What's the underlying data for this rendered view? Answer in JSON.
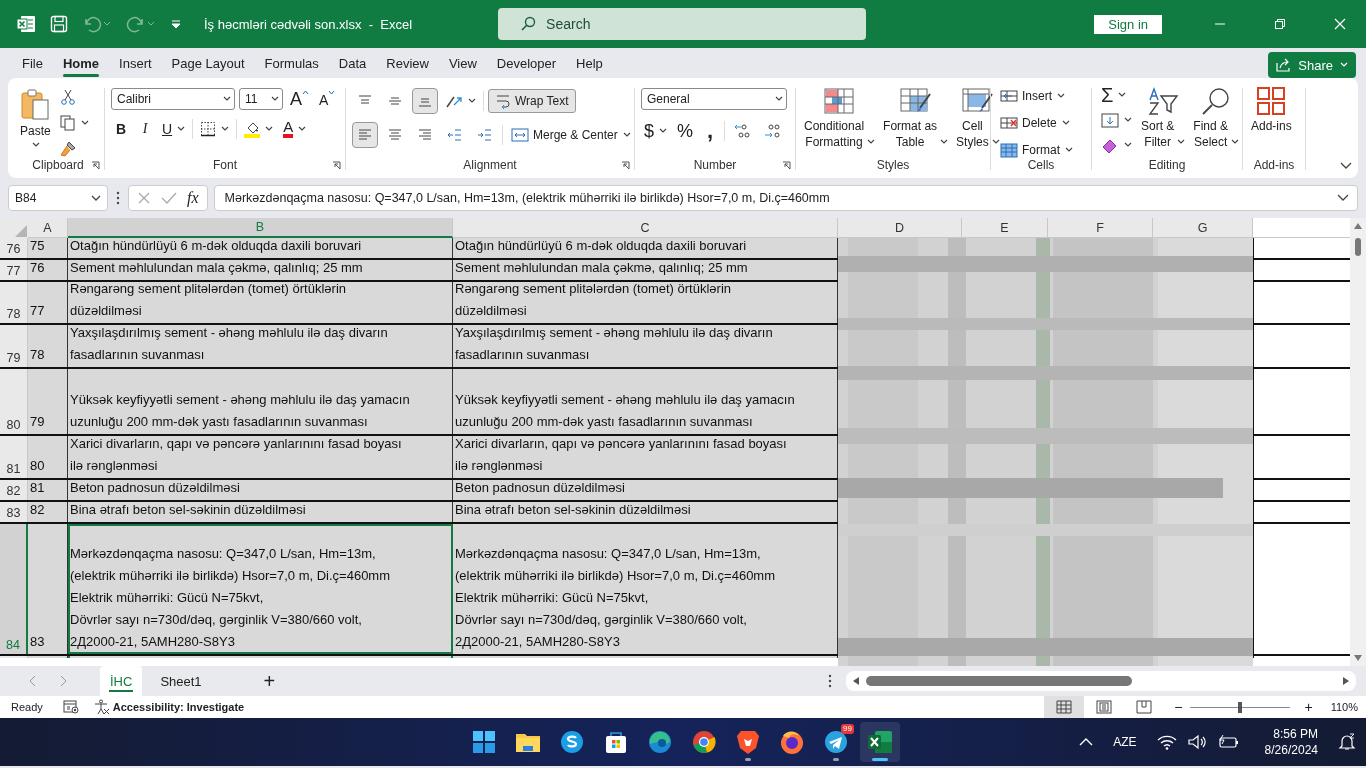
{
  "window": {
    "title": "İş həcmləri cədvəli son.xlsx  -  Excel",
    "search_placeholder": "Search",
    "sign_in": "Sign in"
  },
  "menu_tabs": [
    {
      "label": "File",
      "selected": false
    },
    {
      "label": "Home",
      "selected": true
    },
    {
      "label": "Insert",
      "selected": false
    },
    {
      "label": "Page Layout",
      "selected": false
    },
    {
      "label": "Formulas",
      "selected": false
    },
    {
      "label": "Data",
      "selected": false
    },
    {
      "label": "Review",
      "selected": false
    },
    {
      "label": "View",
      "selected": false
    },
    {
      "label": "Developer",
      "selected": false
    },
    {
      "label": "Help",
      "selected": false
    }
  ],
  "share": "Share",
  "ribbon": {
    "clipboard": {
      "paste": "Paste",
      "label": "Clipboard"
    },
    "font": {
      "name": "Calibri",
      "size": "11",
      "grow_font": "A",
      "shrink_font": "A",
      "bold": "B",
      "italic": "I",
      "underline": "U",
      "font_color": "A",
      "label": "Font"
    },
    "alignment": {
      "vertical": [
        {
          "selected": false
        },
        {
          "selected": false
        },
        {
          "selected": true
        }
      ],
      "horizontal": [
        {
          "selected": true
        },
        {
          "selected": false
        },
        {
          "selected": false
        }
      ],
      "wrap_text": {
        "label": "Wrap Text",
        "on": true
      },
      "merge": "Merge & Center",
      "label": "Alignment"
    },
    "number": {
      "format": "General",
      "currency": "$",
      "percent": "%",
      "comma": ",",
      "label": "Number"
    },
    "styles": {
      "buttons": [
        "Conditional\nFormatting",
        "Format as\nTable",
        "Cell\nStyles"
      ],
      "label": "Styles"
    },
    "cells": {
      "buttons": [
        "Insert",
        "Delete",
        "Format"
      ],
      "label": "Cells"
    },
    "editing": {
      "sum": "Σ",
      "sort": "Sort &\nFilter",
      "find": "Find &\nSelect",
      "label": "Editing"
    },
    "addins": {
      "button": "Add-ins",
      "label": "Add-ins"
    }
  },
  "formula_bar": {
    "name_box": "B84",
    "fx": "fx",
    "formula": "Mərkəzdənqaçma nasosu: Q=347,0 L/san, Hm=13m, (elektrik mühərriki ilə birlikdə) Hsor=7,0 m, Di.ç=460mm"
  },
  "columns": [
    {
      "label": "A",
      "selected": false
    },
    {
      "label": "B",
      "selected": true
    },
    {
      "label": "C",
      "selected": false
    },
    {
      "label": "D",
      "selected": false
    },
    {
      "label": "E",
      "selected": false
    },
    {
      "label": "F",
      "selected": false
    },
    {
      "label": "G",
      "selected": false
    }
  ],
  "rows": [
    {
      "number": "76",
      "a": "75",
      "b": "Otağın hündürlüyü 6 m-dək olduqda daxili boruvari",
      "c": "Otağın hündürlüyü 6 m-dək olduqda daxili boruvari",
      "selected": false
    },
    {
      "number": "77",
      "a": "76",
      "b": "Sement məhlulundan mala çəkmə, qalınlıq; 25 mm",
      "c": "Sement məhlulundan mala çəkmə, qalınlıq; 25 mm",
      "selected": false
    },
    {
      "number": "78",
      "a": "77",
      "b": "Rəngarəng sement plitələrdən (tomet) örtüklərin\ndüzəldilməsi",
      "c": "Rəngarəng sement plitələrdən (tomet) örtüklərin\ndüzəldilməsi",
      "selected": false
    },
    {
      "number": "79",
      "a": "78",
      "b": "Yaxşılaşdırılmış sement - əhəng məhlulu ilə daş divarın\nfasadlarının suvanması",
      "c": "Yaxşılaşdırılmış sement - əhəng məhlulu ilə daş divarın\nfasadlarının suvanması",
      "selected": false
    },
    {
      "number": "80",
      "a": "79",
      "b": "Yüksək keyfiyyətli sement - əhəng məhlulu ilə daş yamacın\nuzunluğu 200 mm-dək yastı fasadlarının suvanması",
      "c": "Yüksək keyfiyyətli sement - əhəng məhlulu ilə daş yamacın\nuzunluğu 200 mm-dək yastı fasadlarının suvanması",
      "selected": false
    },
    {
      "number": "81",
      "a": "80",
      "b": "Xarici divarların, qapı və pəncərə yanlarınını fasad boyası\nilə rənglənməsi",
      "c": "Xarici divarların, qapı və pəncərə yanlarınını fasad boyası\nilə rənglənməsi",
      "selected": false
    },
    {
      "number": "82",
      "a": "81",
      "b": "Beton padnosun düzəldilməsi",
      "c": "Beton padnosun düzəldilməsi",
      "selected": false
    },
    {
      "number": "83",
      "a": "82",
      "b": "Bina ətrafı beton sel-səkinin düzəldilməsi",
      "c": "Bina ətrafı beton sel-səkinin düzəldilməsi",
      "selected": false
    },
    {
      "number": "84",
      "a": "83",
      "b": "Mərkəzdənqaçma nasosu: Q=347,0 L/san, Hm=13m,\n(elektrik mühərriki ilə birlikdə) Hsor=7,0 m, Di.ç=460mm\nElektrik mühərriki: Gücü N=75kvt,\nDövrlər sayı n=730d/dəq, gərginlik V=380/660 volt,\n2Д2000-21, 5AMH280-S8Y3",
      "c": "Mərkəzdənqaçma nasosu: Q=347,0 L/san, Hm=13m,\n(elektrik mühərriki ilə birlikdə) Hsor=7,0 m, Di.ç=460mm\nElektrik mühərriki: Gücü N=75kvt,\nDövrlər sayı n=730d/dəq, gərginlik V=380/660 volt,\n2Д2000-21, 5AMH280-S8Y3",
      "selected": true
    }
  ],
  "sheet_tabs": [
    {
      "label": "İHC",
      "selected": true
    },
    {
      "label": "Sheet1",
      "selected": false
    }
  ],
  "add_sheet": "+",
  "status_bar": {
    "mode": "Ready",
    "accessibility": "Accessibility: Investigate",
    "views": [
      {
        "selected": true
      },
      {
        "selected": false
      },
      {
        "selected": false
      }
    ],
    "zoom_out": "−",
    "zoom_in": "+",
    "zoom_slider": {
      "level": 0.5
    },
    "zoom": "110%"
  },
  "taskbar": {
    "apps": [
      {
        "kind": "start",
        "running": false,
        "selected": false
      },
      {
        "kind": "folder",
        "running": false,
        "selected": false
      },
      {
        "kind": "skype",
        "running": false,
        "selected": false
      },
      {
        "kind": "store",
        "running": false,
        "selected": false
      },
      {
        "kind": "edge",
        "running": false,
        "selected": false
      },
      {
        "kind": "chrome",
        "running": false,
        "selected": false
      },
      {
        "kind": "brave",
        "running": true,
        "selected": false
      },
      {
        "kind": "firefox",
        "running": false,
        "selected": false
      },
      {
        "kind": "telegram",
        "running": true,
        "selected": false,
        "badge": "99"
      },
      {
        "kind": "excel",
        "running": true,
        "selected": true
      }
    ],
    "language": "AZE",
    "time": "8:56 PM",
    "date": "8/26/2024"
  }
}
